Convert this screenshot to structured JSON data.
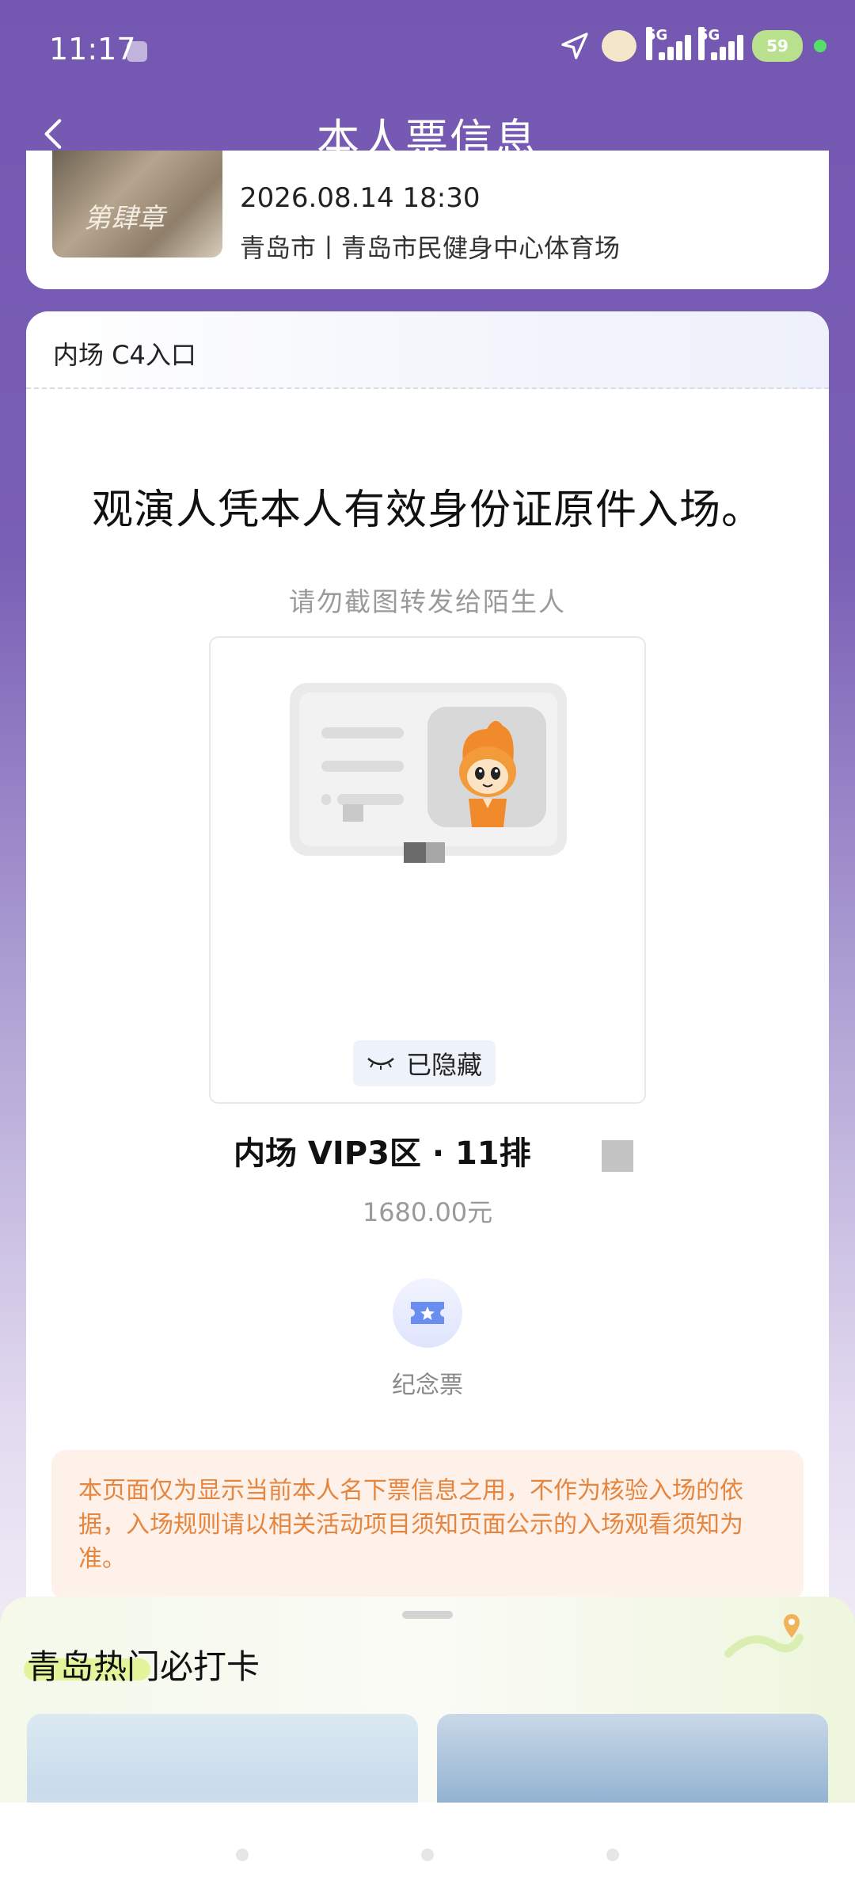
{
  "status": {
    "time": "11:17",
    "signal1_label": "5G",
    "signal2_label": "5G",
    "battery": "59"
  },
  "header": {
    "title": "本人票信息"
  },
  "event": {
    "poster_text": "第肆章",
    "datetime": "2026.08.14 18:30",
    "venue": "青岛市丨青岛市民健身中心体育场"
  },
  "ticket": {
    "entrance": "内场 C4入口",
    "notice": "观演人凭本人有效身份证原件入场。",
    "no_screenshot": "请勿截图转发给陌生人",
    "hidden_label": "已隐藏",
    "seat": "内场 VIP3区 · 11排",
    "price": "1680.00元",
    "souvenir_label": "纪念票",
    "disclaimer": "本页面仅为显示当前本人名下票信息之用，不作为核验入场的依据，入场规则请以相关活动项目须知页面公示的入场观看须知为准。"
  },
  "sheet": {
    "title": "青岛热门必打卡"
  },
  "colors": {
    "brand_purple": "#7457b1",
    "disclaimer_text": "#e5853e",
    "disclaimer_bg": "#fdf1ea"
  },
  "icons": [
    "back-icon",
    "location-arrow-icon",
    "eye-closed-icon",
    "ticket-star-icon",
    "map-pin-icon"
  ]
}
